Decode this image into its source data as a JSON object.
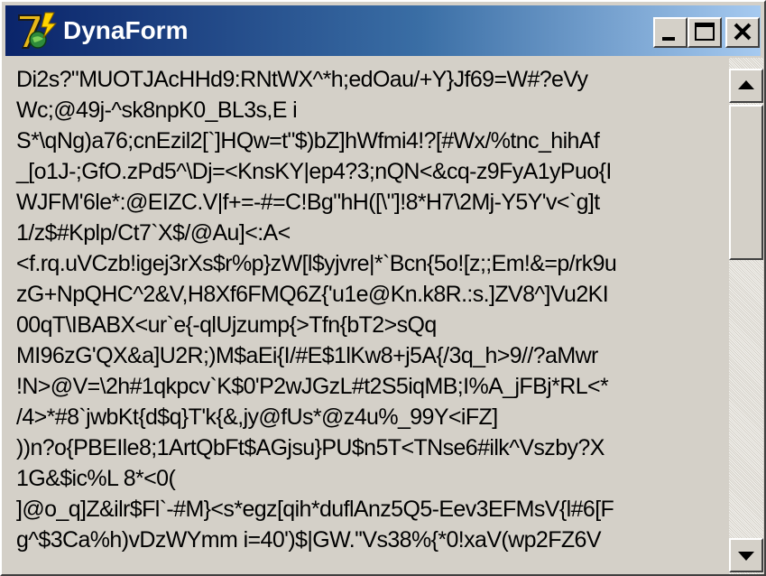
{
  "window": {
    "title": "DynaForm",
    "icon": "dynaform-app-icon",
    "buttons": {
      "minimize_icon": "minimize-icon",
      "maximize_icon": "maximize-icon",
      "close_icon": "close-icon"
    }
  },
  "content": {
    "lines": [
      "Di2s?\"MUOTJAcHHd9:RNtWX^*h;edOau/+Y}Jf69=W#?eVy",
      "Wc;@49j-^sk8npK0_BL3s,E i",
      "S*\\qNg)a76;cnEzil2[`]HQw=t\"$)bZ]hWfmi4!?[#Wx/%tnc_hihAf",
      "_[o1J-;GfO.zPd5^\\Dj=<KnsKY|ep4?3;nQN<&cq-z9FyA1yPuo{I",
      "WJFM'6le*:@EIZC.V|f+=-#=C!Bg\"hH([\\\"]!8*H7\\2Mj-Y5Y'v<`g]t",
      "1/z$#Kplp/Ct7`X$/@Au]<:A<",
      "<f.rq.uVCzb!igej3rXs$r%p}zW[l$yjvre|*`Bcn{5o![z;;Em!&=p/rk9u",
      "zG+NpQHC^2&V,H8Xf6FMQ6Z{'u1e@Kn.k8R.:s.]ZV8^]Vu2KI",
      "00qT\\IBABX<ur`e{-qlUjzump{>Tfn{bT2>sQq",
      "MI96zG'QX&a]U2R;)M$aEi{I/#E$1lKw8+j5A{/3q_h>9//?aMwr",
      "!N>@V=\\2h#1qkpcv`K$0'P2wJGzL#t2S5iqMB;I%A_jFBj*RL<*",
      "/4>*#8`jwbKt{d$q}T'k{&,jy@fUs*@z4u%_99Y<iFZ]",
      "))n?o{PBEIle8;1ArtQbFt$AGjsu}PU$n5T<TNse6#ilk^Vszby?X",
      "1G&$ic%L 8*<0(",
      "]@o_q]Z&ilr$Fl`-#M}<s*egz[qih*duflAnz5Q5-Eev3EFMsV{l#6[F",
      "g^$3Ca%h)vDzWYmm i=40')$|GW.''Vs38%{*0!xaV(wp2FZ6V"
    ]
  },
  "scrollbar": {
    "up_icon": "scroll-up-arrow-icon",
    "down_icon": "scroll-down-arrow-icon"
  },
  "colors": {
    "titlebar_start": "#0a246a",
    "titlebar_end": "#a6caf0",
    "face": "#d4d0c8"
  }
}
